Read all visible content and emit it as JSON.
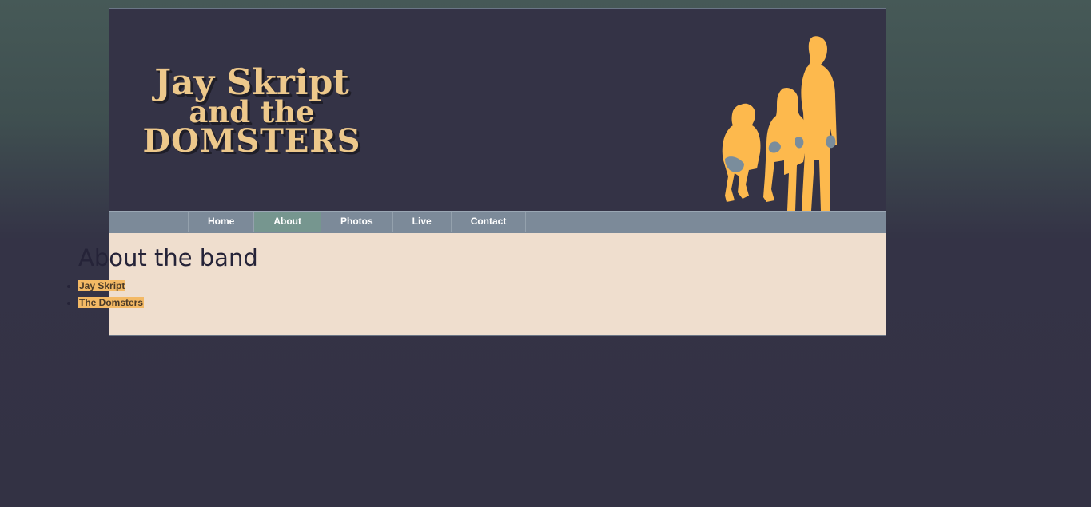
{
  "site": {
    "logo": {
      "line1": "Jay Skript",
      "line2": "and the",
      "line3": "DOMSTERS"
    },
    "header_image": "band-silhouette"
  },
  "nav": {
    "items": [
      {
        "label": "Home",
        "active": false
      },
      {
        "label": "About",
        "active": true
      },
      {
        "label": "Photos",
        "active": false
      },
      {
        "label": "Live",
        "active": false
      },
      {
        "label": "Contact",
        "active": false
      }
    ]
  },
  "main": {
    "heading": "About the band",
    "links": [
      {
        "label": "Jay Skript"
      },
      {
        "label": "The Domsters"
      }
    ]
  },
  "colors": {
    "header_bg": "#343346",
    "nav_bg": "#7c8a99",
    "nav_active": "#76968f",
    "content_bg": "#efdece",
    "logo": "#edc88b",
    "silhouette": "#fdb94d",
    "link_highlight": "#f3b965"
  }
}
